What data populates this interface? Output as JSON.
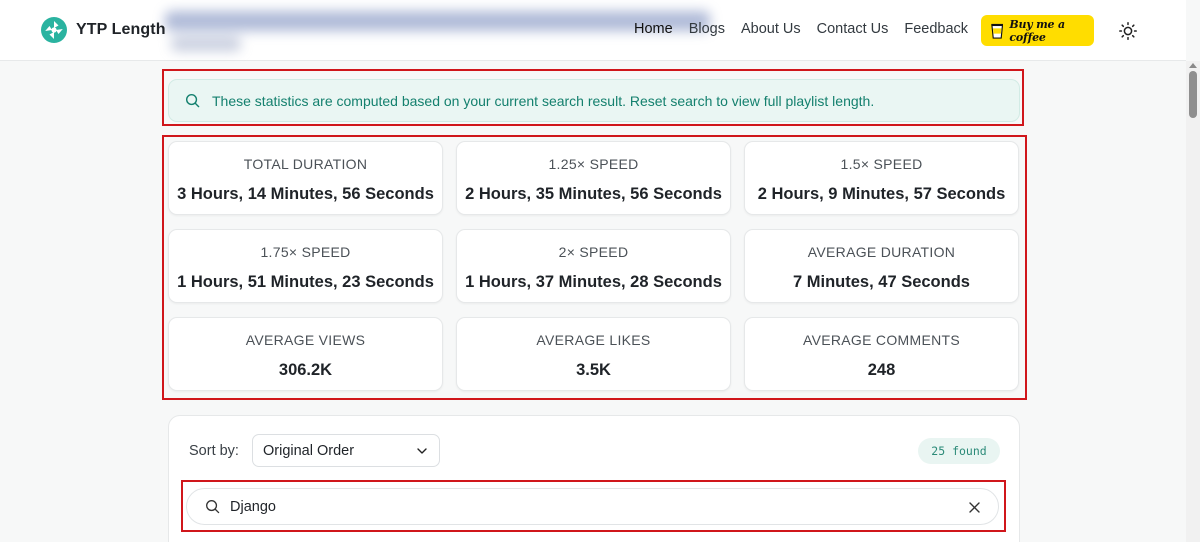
{
  "header": {
    "brand": "YTP Length",
    "nav": [
      {
        "label": "Home",
        "active": true
      },
      {
        "label": "Blogs",
        "active": false
      },
      {
        "label": "About Us",
        "active": false
      },
      {
        "label": "Contact Us",
        "active": false
      },
      {
        "label": "Feedback",
        "active": false
      }
    ],
    "coffee_label": "Buy me a coffee",
    "accent_color": "#2ab3a0",
    "coffee_color": "#ffdd00"
  },
  "notice": {
    "text": "These statistics are computed based on your current search result. Reset search to view full playlist length."
  },
  "stats": [
    {
      "label": "TOTAL DURATION",
      "value": "3 Hours, 14 Minutes, 56 Seconds"
    },
    {
      "label": "1.25× SPEED",
      "value": "2 Hours, 35 Minutes, 56 Seconds"
    },
    {
      "label": "1.5× SPEED",
      "value": "2 Hours, 9 Minutes, 57 Seconds"
    },
    {
      "label": "1.75× SPEED",
      "value": "1 Hours, 51 Minutes, 23 Seconds"
    },
    {
      "label": "2× SPEED",
      "value": "1 Hours, 37 Minutes, 28 Seconds"
    },
    {
      "label": "AVERAGE DURATION",
      "value": "7 Minutes, 47 Seconds"
    },
    {
      "label": "AVERAGE VIEWS",
      "value": "306.2K"
    },
    {
      "label": "AVERAGE LIKES",
      "value": "3.5K"
    },
    {
      "label": "AVERAGE COMMENTS",
      "value": "248"
    }
  ],
  "list": {
    "sort_label": "Sort by:",
    "sort_value": "Original Order",
    "found": "25 found",
    "search_value": "Django"
  }
}
